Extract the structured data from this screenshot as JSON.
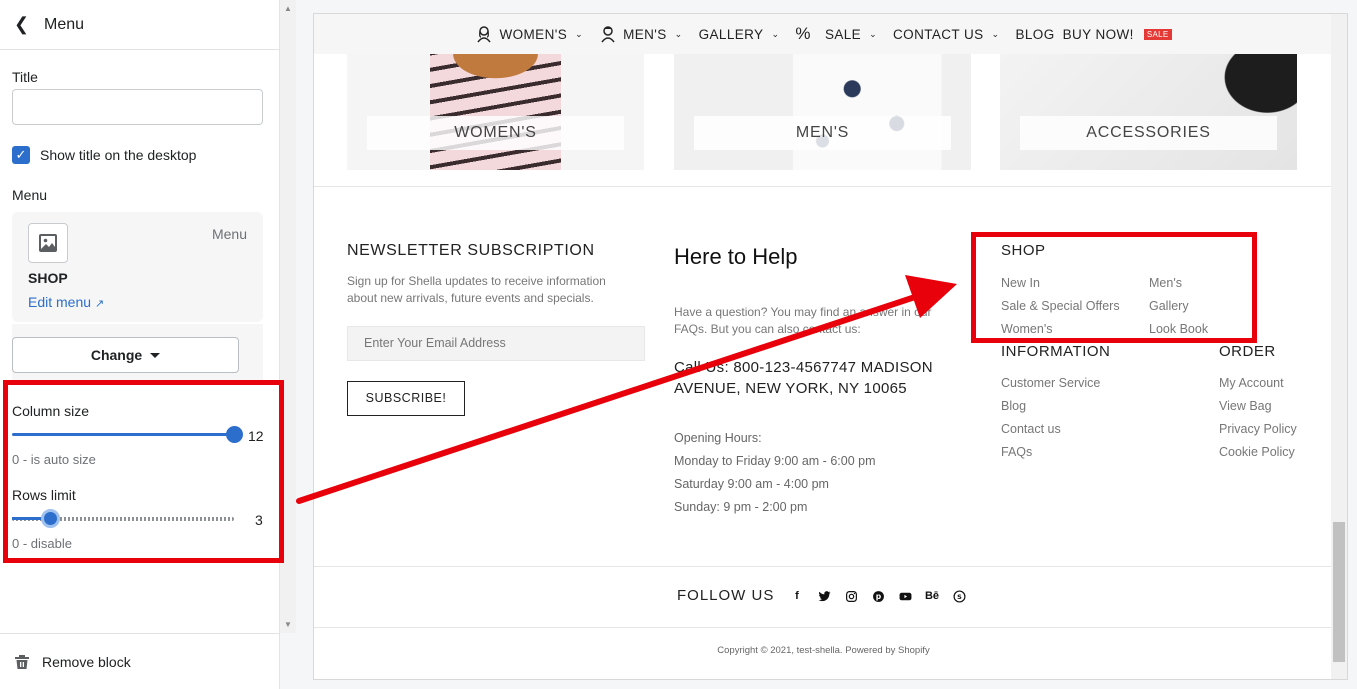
{
  "sidebar": {
    "header": {
      "back_icon": "chevron-left-icon",
      "title": "Menu"
    },
    "title_label": "Title",
    "title_value": "",
    "show_title_label": "Show title on the desktop",
    "show_title_checked": true,
    "menu_label": "Menu",
    "menu_card": {
      "type": "Menu",
      "name": "SHOP",
      "edit_label": "Edit menu"
    },
    "change_label": "Change",
    "column_size": {
      "label": "Column size",
      "value": "12",
      "fraction": 1.0,
      "hint": "0 - is auto size"
    },
    "rows_limit": {
      "label": "Rows limit",
      "value": "3",
      "fraction": 0.17,
      "hint": "0 - disable"
    },
    "remove_label": "Remove block"
  },
  "preview": {
    "nav": [
      {
        "label": "WOMEN'S",
        "icon": "woman-icon",
        "dropdown": true
      },
      {
        "label": "MEN'S",
        "icon": "man-icon",
        "dropdown": true
      },
      {
        "label": "GALLERY",
        "icon": "",
        "dropdown": true
      },
      {
        "label": "SALE",
        "icon": "percent-icon",
        "dropdown": true
      },
      {
        "label": "CONTACT US",
        "icon": "",
        "dropdown": true
      },
      {
        "label": "BLOG",
        "icon": "",
        "dropdown": false
      },
      {
        "label": "BUY NOW!",
        "icon": "",
        "dropdown": false,
        "badge": "SALE"
      }
    ],
    "categories": [
      "WOMEN'S",
      "MEN'S",
      "ACCESSORIES"
    ],
    "newsletter": {
      "title": "NEWSLETTER SUBSCRIPTION",
      "desc": "Sign up for Shella updates to receive information about new arrivals, future events and specials.",
      "placeholder": "Enter Your Email Address",
      "button": "SUBSCRIBE!"
    },
    "help": {
      "title": "Here to Help",
      "desc": "Have a question? You may find an answer in our FAQs. But you can also contact us:",
      "call": "Call Us: 800-123-4567747 MADISON AVENUE, NEW YORK, NY 10065",
      "hours": [
        "Opening Hours:",
        "Monday to Friday 9:00 am - 6:00 pm",
        "Saturday 9:00 am - 4:00 pm",
        "Sunday: 9 pm - 2:00 pm"
      ]
    },
    "shop": {
      "title": "SHOP",
      "col1": [
        "New In",
        "Sale & Special Offers",
        "Women's"
      ],
      "col2": [
        "Men's",
        "Gallery",
        "Look Book"
      ]
    },
    "information": {
      "title": "INFORMATION",
      "links": [
        "Customer Service",
        "Blog",
        "Contact us",
        "FAQs"
      ]
    },
    "order": {
      "title": "ORDER",
      "links": [
        "My Account",
        "View Bag",
        "Privacy Policy",
        "Cookie Policy"
      ]
    },
    "follow": {
      "title": "FOLLOW US",
      "icons": [
        "facebook-icon",
        "twitter-icon",
        "instagram-icon",
        "pinterest-icon",
        "youtube-icon",
        "behance-icon",
        "skype-icon"
      ]
    },
    "copyright": "Copyright © 2021, test-shella. Powered by Shopify"
  },
  "colors": {
    "accent": "#2c6ecb",
    "annotation": "#e8000b",
    "sale_badge": "#e53935"
  }
}
